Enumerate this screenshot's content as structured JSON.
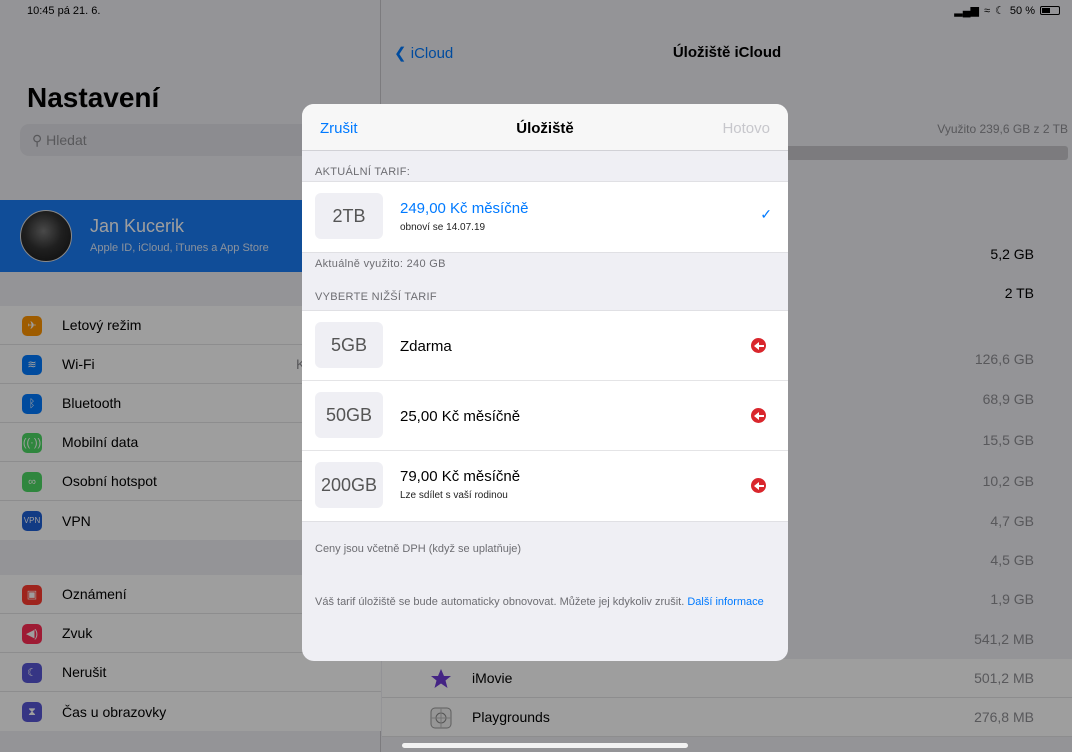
{
  "status": {
    "time": "10:45",
    "date": "pá 21. 6.",
    "battery": "50 %"
  },
  "sidebar": {
    "title": "Nastavení",
    "search_placeholder": "Hledat",
    "profile": {
      "name": "Jan Kucerik",
      "subtitle": "Apple ID, iCloud, iTunes a App Store"
    },
    "group1": [
      {
        "label": "Letový režim",
        "icon": "airplane-icon",
        "color": "#ff9500"
      },
      {
        "label": "Wi-Fi",
        "icon": "wifi-icon",
        "color": "#007aff",
        "value": "K"
      },
      {
        "label": "Bluetooth",
        "icon": "bluetooth-icon",
        "color": "#007aff"
      },
      {
        "label": "Mobilní data",
        "icon": "antenna-icon",
        "color": "#4cd964"
      },
      {
        "label": "Osobní hotspot",
        "icon": "hotspot-icon",
        "color": "#4cd964"
      },
      {
        "label": "VPN",
        "icon": "vpn-icon",
        "color": "#1e5fd6"
      }
    ],
    "group2": [
      {
        "label": "Oznámení",
        "icon": "notifications-icon",
        "color": "#ff3b30"
      },
      {
        "label": "Zvuk",
        "icon": "sound-icon",
        "color": "#ff2d55"
      },
      {
        "label": "Nerušit",
        "icon": "moon-icon",
        "color": "#5856d6"
      },
      {
        "label": "Čas u obrazovky",
        "icon": "hourglass-icon",
        "color": "#5856d6"
      }
    ]
  },
  "detail": {
    "back": "iCloud",
    "title": "Úložiště iCloud",
    "usage": "Využito 239,6 GB z 2 TB",
    "values": [
      "5,2 GB",
      "2 TB",
      "126,6 GB",
      "68,9 GB",
      "15,5 GB",
      "10,2 GB",
      "4,7 GB",
      "4,5 GB",
      "1,9 GB",
      "541,2 MB"
    ],
    "apps": [
      {
        "name": "iMovie",
        "value": "501,2 MB",
        "icon": "imovie-icon"
      },
      {
        "name": "Playgrounds",
        "value": "276,8 MB",
        "icon": "playgrounds-icon"
      }
    ]
  },
  "modal": {
    "cancel": "Zrušit",
    "title": "Úložiště",
    "done": "Hotovo",
    "current_header": "AKTUÁLNÍ TARIF:",
    "current": {
      "tier": "2TB",
      "price": "249,00 Kč měsíčně",
      "renew": "obnoví se 14.07.19"
    },
    "current_usage": "Aktuálně využito: 240 GB",
    "lower_header": "VYBERTE NIŽŠÍ TARIF",
    "plans": [
      {
        "tier": "5GB",
        "price": "Zdarma"
      },
      {
        "tier": "50GB",
        "price": "25,00 Kč měsíčně"
      },
      {
        "tier": "200GB",
        "price": "79,00 Kč měsíčně",
        "sub": "Lze sdílet s vaší rodinou"
      }
    ],
    "vat_note": "Ceny jsou včetně DPH (když se uplatňuje)",
    "renew_note": "Váš tarif úložiště se bude automaticky obnovovat. Můžete jej kdykoliv zrušit.",
    "more_link": "Další informace"
  }
}
